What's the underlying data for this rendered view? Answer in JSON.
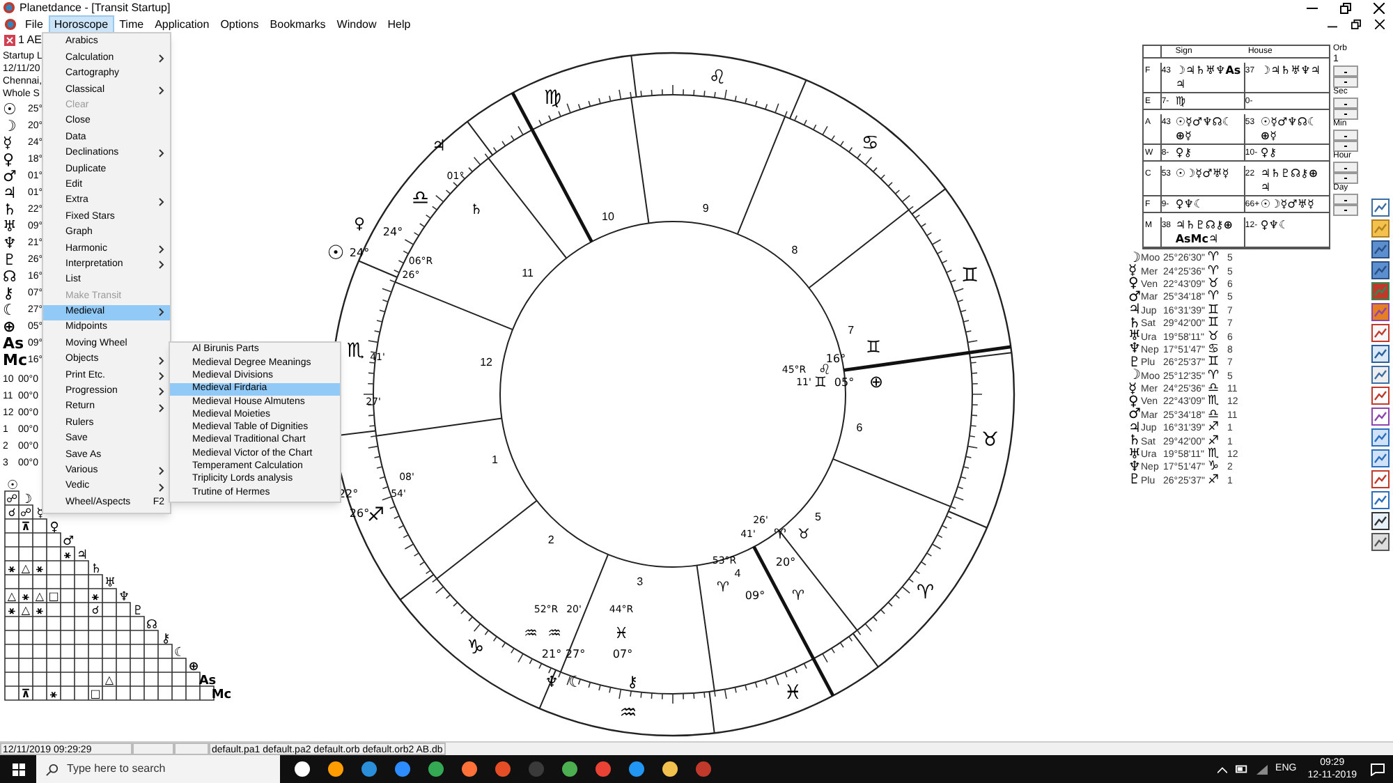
{
  "window": {
    "title": "Planetdance - [Transit Startup]"
  },
  "menu_bar": [
    {
      "label": "File",
      "selected": false
    },
    {
      "label": "Horoscope",
      "selected": true
    },
    {
      "label": "Time",
      "selected": false
    },
    {
      "label": "Application",
      "selected": false
    },
    {
      "label": "Options",
      "selected": false
    },
    {
      "label": "Bookmarks",
      "selected": false
    },
    {
      "label": "Window",
      "selected": false
    },
    {
      "label": "Help",
      "selected": false
    }
  ],
  "document_tab": {
    "label": "1 AE"
  },
  "horoscope_menu": [
    {
      "label": "Arabics",
      "submenu": false,
      "disabled": false,
      "selected": false
    },
    {
      "label": "Calculation",
      "submenu": true,
      "disabled": false,
      "selected": false
    },
    {
      "label": "Cartography",
      "submenu": false,
      "disabled": false,
      "selected": false
    },
    {
      "label": "Classical",
      "submenu": true,
      "disabled": false,
      "selected": false
    },
    {
      "label": "Clear",
      "submenu": false,
      "disabled": true,
      "selected": false
    },
    {
      "label": "Close",
      "submenu": false,
      "disabled": false,
      "selected": false
    },
    {
      "label": "Data",
      "submenu": false,
      "disabled": false,
      "selected": false
    },
    {
      "label": "Declinations",
      "submenu": true,
      "disabled": false,
      "selected": false
    },
    {
      "label": "Duplicate",
      "submenu": false,
      "disabled": false,
      "selected": false
    },
    {
      "label": "Edit",
      "submenu": false,
      "disabled": false,
      "selected": false
    },
    {
      "label": "Extra",
      "submenu": true,
      "disabled": false,
      "selected": false
    },
    {
      "label": "Fixed Stars",
      "submenu": false,
      "disabled": false,
      "selected": false
    },
    {
      "label": "Graph",
      "submenu": false,
      "disabled": false,
      "selected": false
    },
    {
      "label": "Harmonic",
      "submenu": true,
      "disabled": false,
      "selected": false
    },
    {
      "label": "Interpretation",
      "submenu": true,
      "disabled": false,
      "selected": false
    },
    {
      "label": "List",
      "submenu": false,
      "disabled": false,
      "selected": false
    },
    {
      "label": "Make Transit",
      "submenu": false,
      "disabled": true,
      "selected": false
    },
    {
      "label": "Medieval",
      "submenu": true,
      "disabled": false,
      "selected": true
    },
    {
      "label": "Midpoints",
      "submenu": false,
      "disabled": false,
      "selected": false
    },
    {
      "label": "Moving Wheel",
      "submenu": false,
      "disabled": false,
      "selected": false
    },
    {
      "label": "Objects",
      "submenu": true,
      "disabled": false,
      "selected": false
    },
    {
      "label": "Print Etc.",
      "submenu": true,
      "disabled": false,
      "selected": false
    },
    {
      "label": "Progression",
      "submenu": true,
      "disabled": false,
      "selected": false
    },
    {
      "label": "Return",
      "submenu": true,
      "disabled": false,
      "selected": false
    },
    {
      "label": "Rulers",
      "submenu": false,
      "disabled": false,
      "selected": false
    },
    {
      "label": "Save",
      "submenu": false,
      "disabled": false,
      "selected": false
    },
    {
      "label": "Save As",
      "submenu": false,
      "disabled": false,
      "selected": false
    },
    {
      "label": "Various",
      "submenu": true,
      "disabled": false,
      "selected": false
    },
    {
      "label": "Vedic",
      "submenu": true,
      "disabled": false,
      "selected": false
    },
    {
      "label": "Wheel/Aspects",
      "shortcut": "F2",
      "submenu": false,
      "disabled": false,
      "selected": false
    }
  ],
  "medieval_submenu": [
    {
      "label": "Al Birunis Parts",
      "selected": false
    },
    {
      "label": "Medieval Degree Meanings",
      "selected": false
    },
    {
      "label": "Medieval Divisions",
      "selected": false
    },
    {
      "label": "Medieval Firdaria",
      "selected": true
    },
    {
      "label": "Medieval House Almutens",
      "selected": false
    },
    {
      "label": "Medieval Moieties",
      "selected": false
    },
    {
      "label": "Medieval Table of Dignities",
      "selected": false
    },
    {
      "label": "Medieval Traditional Chart",
      "selected": false
    },
    {
      "label": "Medieval Victor of the Chart",
      "selected": false
    },
    {
      "label": "Temperament Calculation",
      "selected": false
    },
    {
      "label": "Triplicity Lords analysis",
      "selected": false
    },
    {
      "label": "Trutine of Hermes",
      "selected": false
    }
  ],
  "left_panel": {
    "header_lines": [
      "Startup L",
      "12/11/20",
      "Chennai,",
      "Whole S"
    ],
    "planets": [
      {
        "glyph": "☉",
        "degree": "25°"
      },
      {
        "glyph": "☽",
        "degree": "20°"
      },
      {
        "glyph": "☿",
        "degree": "24°"
      },
      {
        "glyph": "♀",
        "degree": "18°"
      },
      {
        "glyph": "♂",
        "degree": "01°"
      },
      {
        "glyph": "♃",
        "degree": "01°"
      },
      {
        "glyph": "♄",
        "degree": "22°"
      },
      {
        "glyph": "♅",
        "degree": "09°"
      },
      {
        "glyph": "♆",
        "degree": "21°"
      },
      {
        "glyph": "♇",
        "degree": "26°"
      },
      {
        "glyph": "☊",
        "degree": "16°"
      },
      {
        "glyph": "⚷",
        "degree": "07°"
      },
      {
        "glyph": "☾",
        "degree": "27°"
      },
      {
        "glyph": "⊕",
        "degree": "05°"
      },
      {
        "glyph": "As",
        "degree": "09°"
      },
      {
        "glyph": "Mc",
        "degree": "16°"
      }
    ],
    "houses": [
      {
        "number": "10",
        "position": "00°0"
      },
      {
        "number": "11",
        "position": "00°0"
      },
      {
        "number": "12",
        "position": "00°0"
      },
      {
        "number": "1",
        "position": "00°0"
      },
      {
        "number": "2",
        "position": "00°0"
      },
      {
        "number": "3",
        "position": "00°0"
      }
    ]
  },
  "aspect_grid": [
    {
      "planet": "☉"
    },
    {
      "planet": "☽",
      "cells": [
        {
          "kind": "aspect",
          "glyph": "☍"
        }
      ]
    },
    {
      "planet": "☿",
      "cells": [
        {
          "kind": "aspect",
          "glyph": "☌"
        },
        {
          "kind": "aspect",
          "glyph": "☍"
        }
      ]
    },
    {
      "planet": "♀",
      "cells": [
        {
          "kind": "empty"
        },
        {
          "kind": "aspect",
          "glyph": "⊼"
        },
        {
          "kind": "empty"
        }
      ]
    },
    {
      "planet": "♂",
      "cells": [
        {
          "kind": "empty"
        },
        {
          "kind": "empty"
        },
        {
          "kind": "empty"
        },
        {
          "kind": "empty"
        }
      ]
    },
    {
      "planet": "♃",
      "cells": [
        {
          "kind": "empty"
        },
        {
          "kind": "empty"
        },
        {
          "kind": "empty"
        },
        {
          "kind": "empty"
        },
        {
          "kind": "aspect",
          "glyph": "⚹"
        }
      ]
    },
    {
      "planet": "♄",
      "cells": [
        {
          "kind": "aspect",
          "glyph": "⚹"
        },
        {
          "kind": "aspect",
          "glyph": "△"
        },
        {
          "kind": "aspect",
          "glyph": "⚹"
        },
        {
          "kind": "empty"
        },
        {
          "kind": "empty"
        },
        {
          "kind": "empty"
        }
      ]
    },
    {
      "planet": "♅",
      "cells": [
        {
          "kind": "empty"
        },
        {
          "kind": "empty"
        },
        {
          "kind": "empty"
        },
        {
          "kind": "empty"
        },
        {
          "kind": "empty"
        },
        {
          "kind": "empty"
        },
        {
          "kind": "empty"
        }
      ]
    },
    {
      "planet": "♆",
      "cells": [
        {
          "kind": "aspect",
          "glyph": "△"
        },
        {
          "kind": "aspect",
          "glyph": "⚹"
        },
        {
          "kind": "aspect",
          "glyph": "△"
        },
        {
          "kind": "aspect",
          "glyph": "□"
        },
        {
          "kind": "empty"
        },
        {
          "kind": "empty"
        },
        {
          "kind": "aspect",
          "glyph": "⚹"
        },
        {
          "kind": "empty"
        }
      ]
    },
    {
      "planet": "♇",
      "cells": [
        {
          "kind": "aspect",
          "glyph": "⚹"
        },
        {
          "kind": "aspect",
          "glyph": "△"
        },
        {
          "kind": "aspect",
          "glyph": "⚹"
        },
        {
          "kind": "empty"
        },
        {
          "kind": "empty"
        },
        {
          "kind": "empty"
        },
        {
          "kind": "aspect",
          "glyph": "☌"
        },
        {
          "kind": "empty"
        },
        {
          "kind": "empty"
        }
      ]
    },
    {
      "planet": "☊",
      "cells": [
        {
          "kind": "empty"
        },
        {
          "kind": "empty"
        },
        {
          "kind": "empty"
        },
        {
          "kind": "empty"
        },
        {
          "kind": "empty"
        },
        {
          "kind": "empty"
        },
        {
          "kind": "empty"
        },
        {
          "kind": "empty"
        },
        {
          "kind": "empty"
        },
        {
          "kind": "empty"
        }
      ]
    },
    {
      "planet": "⚷",
      "cells": [
        {
          "kind": "empty"
        },
        {
          "kind": "empty"
        },
        {
          "kind": "empty"
        },
        {
          "kind": "empty"
        },
        {
          "kind": "empty"
        },
        {
          "kind": "empty"
        },
        {
          "kind": "empty"
        },
        {
          "kind": "empty"
        },
        {
          "kind": "empty"
        },
        {
          "kind": "empty"
        },
        {
          "kind": "empty"
        }
      ]
    },
    {
      "planet": "☾",
      "cells": [
        {
          "kind": "empty"
        },
        {
          "kind": "empty"
        },
        {
          "kind": "empty"
        },
        {
          "kind": "empty"
        },
        {
          "kind": "empty"
        },
        {
          "kind": "empty"
        },
        {
          "kind": "empty"
        },
        {
          "kind": "empty"
        },
        {
          "kind": "empty"
        },
        {
          "kind": "empty"
        },
        {
          "kind": "empty"
        },
        {
          "kind": "empty"
        }
      ]
    },
    {
      "planet": "⊕",
      "cells": [
        {
          "kind": "empty"
        },
        {
          "kind": "empty"
        },
        {
          "kind": "empty"
        },
        {
          "kind": "empty"
        },
        {
          "kind": "empty"
        },
        {
          "kind": "empty"
        },
        {
          "kind": "empty"
        },
        {
          "kind": "empty"
        },
        {
          "kind": "empty"
        },
        {
          "kind": "empty"
        },
        {
          "kind": "empty"
        },
        {
          "kind": "empty"
        },
        {
          "kind": "empty"
        }
      ]
    },
    {
      "planet": "As",
      "cells": [
        {
          "kind": "empty"
        },
        {
          "kind": "empty"
        },
        {
          "kind": "empty"
        },
        {
          "kind": "empty"
        },
        {
          "kind": "empty"
        },
        {
          "kind": "empty"
        },
        {
          "kind": "empty"
        },
        {
          "kind": "aspect",
          "glyph": "△"
        },
        {
          "kind": "empty"
        },
        {
          "kind": "empty"
        },
        {
          "kind": "empty"
        },
        {
          "kind": "empty"
        },
        {
          "kind": "empty"
        },
        {
          "kind": "empty"
        }
      ]
    },
    {
      "planet": "Mc",
      "cells": [
        {
          "kind": "empty"
        },
        {
          "kind": "aspect",
          "glyph": "⊼"
        },
        {
          "kind": "empty"
        },
        {
          "kind": "aspect",
          "glyph": "⚹"
        },
        {
          "kind": "empty"
        },
        {
          "kind": "empty"
        },
        {
          "kind": "aspect",
          "glyph": "□"
        },
        {
          "kind": "empty"
        },
        {
          "kind": "empty"
        },
        {
          "kind": "empty"
        },
        {
          "kind": "empty"
        },
        {
          "kind": "empty"
        },
        {
          "kind": "empty"
        },
        {
          "kind": "empty"
        },
        {
          "kind": "empty"
        }
      ]
    }
  ],
  "chart": {
    "house_numbers": [
      "1",
      "2",
      "3",
      "4",
      "5",
      "6",
      "7",
      "8",
      "9",
      "10",
      "11",
      "12"
    ],
    "signs": [
      "♌",
      "♍",
      "♎",
      "♏",
      "♐",
      "♑",
      "♒",
      "♓",
      "♈",
      "♉",
      "♊",
      "♋"
    ],
    "labels": [
      "♃",
      "01°",
      "♄",
      "♀",
      "24°",
      "☉",
      "24°",
      "06°R",
      "26°",
      "♊",
      "41'",
      "16°",
      "45°R",
      "♌",
      "11'",
      "♊",
      "05°",
      "⊕",
      "27'",
      "08'",
      "22°",
      "54'",
      "26°",
      "26'",
      "41'",
      "♈",
      "♉",
      "53°R",
      "20°",
      "♈",
      "09°",
      "♈",
      "52°R",
      "20'",
      "44°R",
      "♒",
      "♒",
      "♓",
      "21°",
      "27°",
      "07°",
      "♆",
      "☾",
      "⚷"
    ]
  },
  "element_table": {
    "columns": [
      "Sign",
      "House"
    ],
    "rows": [
      {
        "letter": "F",
        "sign_score": "43",
        "sign_planets": "☽♃♄♅♆As ♃",
        "house_score": "37",
        "house_planets": "☽♃♄♅♆♃"
      },
      {
        "letter": "E",
        "sign_score": "7-",
        "sign_planets": "♍",
        "house_score": "0-"
      },
      {
        "letter": "A",
        "sign_score": "43",
        "sign_planets": "☉☿♂♆☊☾ ⊕☿",
        "house_score": "53",
        "house_planets": "☉☿♂♆☊☾ ⊕☿"
      },
      {
        "letter": "W",
        "sign_score": "8-",
        "sign_planets": "♀⚷",
        "house_score": "10-",
        "house_planets": "♀⚷"
      },
      {
        "letter": "C",
        "sign_score": "53",
        "sign_planets": "☉☽☿♂♅☿",
        "house_score": "22",
        "house_planets": "♃♄♇☊⚷⊕ ♃"
      },
      {
        "letter": "F",
        "sign_score": "9-",
        "sign_planets": "♀♆☾",
        "house_score": "66+",
        "house_planets": "☉☽☿♂♅☿"
      },
      {
        "letter": "M",
        "sign_score": "38",
        "sign_planets": "♃♄♇☊⚷⊕ AsMc♃",
        "house_score": "12-",
        "house_planets": "♀♆☾"
      }
    ]
  },
  "spinners": [
    {
      "label": "Orb",
      "value": "1"
    },
    {
      "label": "Sec"
    },
    {
      "label": "Min"
    },
    {
      "label": "Hour"
    },
    {
      "label": "Day"
    }
  ],
  "positions": [
    {
      "glyph": "☽",
      "name": "Moo",
      "position": "25°26'30\"",
      "sign": "♈",
      "house": "5"
    },
    {
      "glyph": "☿",
      "name": "Mer",
      "position": "24°25'36\"",
      "sign": "♈",
      "house": "5"
    },
    {
      "glyph": "♀",
      "name": "Ven",
      "position": "22°43'09\"",
      "sign": "♉",
      "house": "6"
    },
    {
      "glyph": "♂",
      "name": "Mar",
      "position": "25°34'18\"",
      "sign": "♈",
      "house": "5"
    },
    {
      "glyph": "♃",
      "name": "Jup",
      "position": "16°31'39\"",
      "sign": "♊",
      "house": "7"
    },
    {
      "glyph": "♄",
      "name": "Sat",
      "position": "29°42'00\"",
      "sign": "♊",
      "house": "7"
    },
    {
      "glyph": "♅",
      "name": "Ura",
      "position": "19°58'11\"",
      "sign": "♉",
      "house": "6"
    },
    {
      "glyph": "♆",
      "name": "Nep",
      "position": "17°51'47\"",
      "sign": "♋",
      "house": "8"
    },
    {
      "glyph": "♇",
      "name": "Plu",
      "position": "26°25'37\"",
      "sign": "♊",
      "house": "7"
    },
    {
      "glyph": "☽",
      "name": "Moo",
      "position": "25°12'35\"",
      "sign": "♈",
      "house": "5"
    },
    {
      "glyph": "☿",
      "name": "Mer",
      "position": "24°25'36\"",
      "sign": "♎",
      "house": "11"
    },
    {
      "glyph": "♀",
      "name": "Ven",
      "position": "22°43'09\"",
      "sign": "♏",
      "house": "12"
    },
    {
      "glyph": "♂",
      "name": "Mar",
      "position": "25°34'18\"",
      "sign": "♎",
      "house": "11"
    },
    {
      "glyph": "♃",
      "name": "Jup",
      "position": "16°31'39\"",
      "sign": "♐",
      "house": "1"
    },
    {
      "glyph": "♄",
      "name": "Sat",
      "position": "29°42'00\"",
      "sign": "♐",
      "house": "1"
    },
    {
      "glyph": "♅",
      "name": "Ura",
      "position": "19°58'11\"",
      "sign": "♏",
      "house": "12"
    },
    {
      "glyph": "♆",
      "name": "Nep",
      "position": "17°51'47\"",
      "sign": "♑",
      "house": "2"
    },
    {
      "glyph": "♇",
      "name": "Plu",
      "position": "26°25'37\"",
      "sign": "♐",
      "house": "1"
    }
  ],
  "status_bar": {
    "datetime": "12/11/2019 09:29:29",
    "files": "default.pa1 default.pa2 default.orb default.orb2 AB.db"
  },
  "taskbar": {
    "search_placeholder": "Type here to search",
    "language": "ENG",
    "time": "09:29",
    "date": "12-11-2019"
  }
}
